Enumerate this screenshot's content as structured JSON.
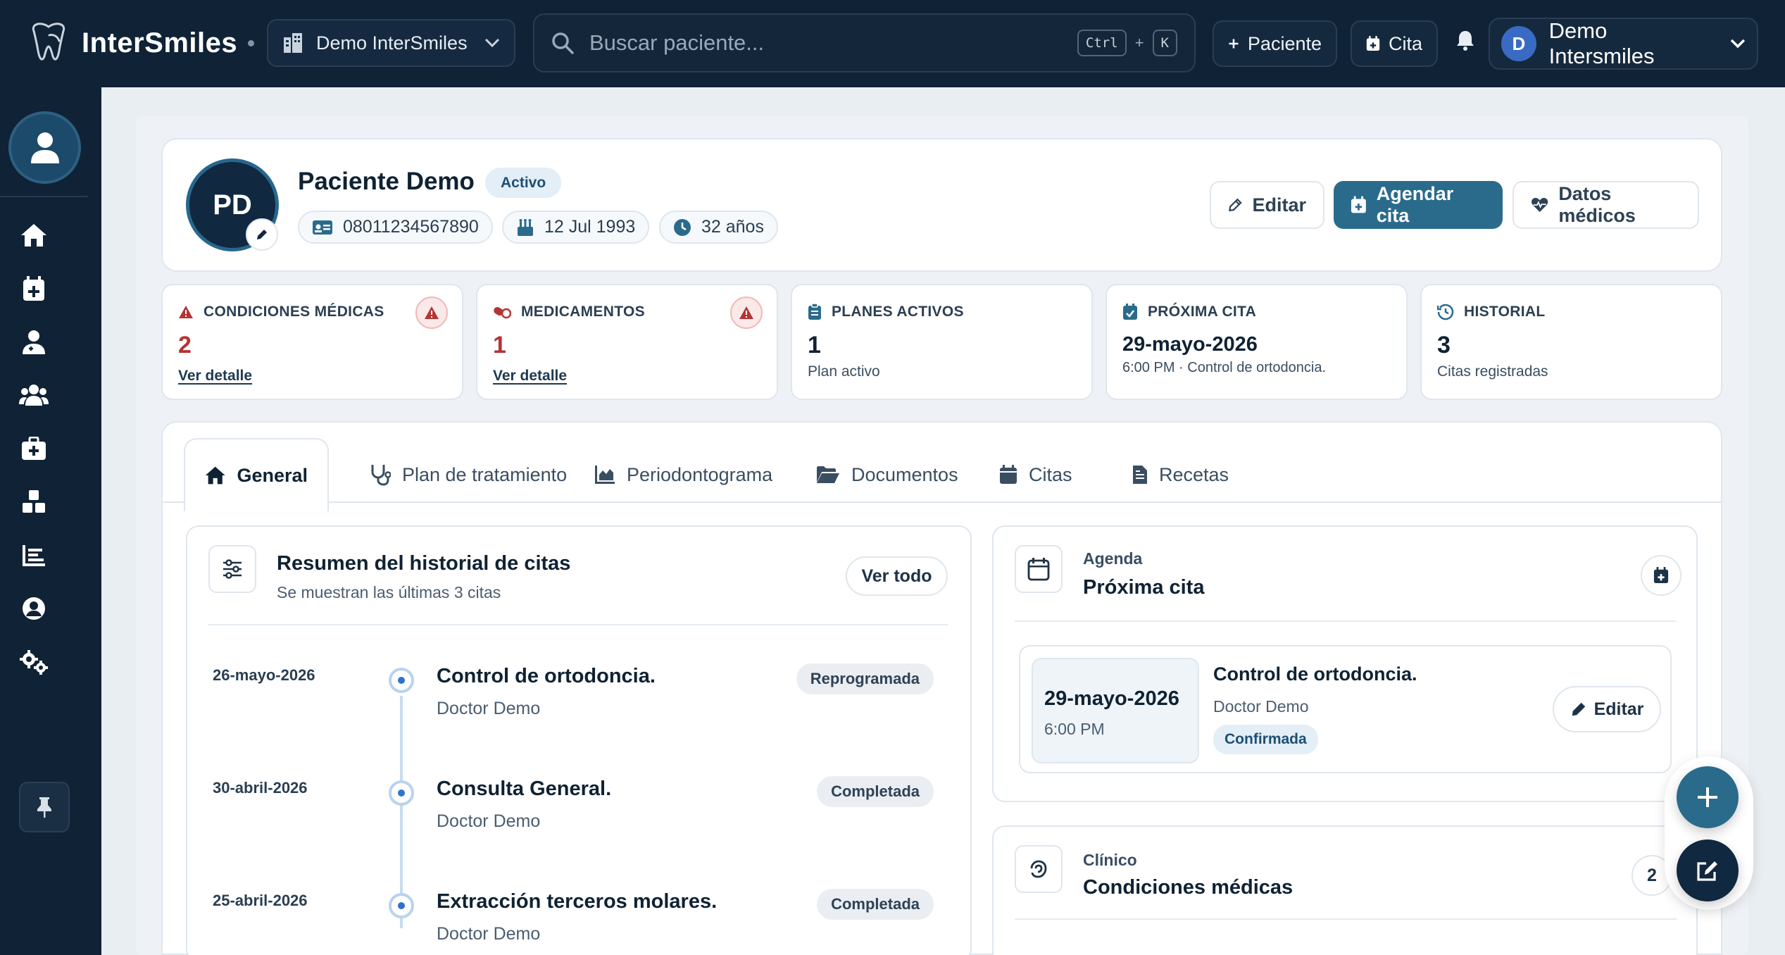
{
  "app": {
    "name": "InterSmiles"
  },
  "topbar": {
    "clinic": "Demo InterSmiles",
    "search_placeholder": "Buscar paciente...",
    "kbd_ctrl": "Ctrl",
    "kbd_plus": "+",
    "kbd_k": "K",
    "btn_paciente": "Paciente",
    "btn_cita": "Cita",
    "user_initial": "D",
    "user_name": "Demo Intersmiles"
  },
  "patient": {
    "initials": "PD",
    "name": "Paciente Demo",
    "status": "Activo",
    "id_number": "08011234567890",
    "birthdate": "12 Jul 1993",
    "age": "32 años"
  },
  "header_actions": {
    "edit": "Editar",
    "schedule": "Agendar cita",
    "medical": "Datos médicos"
  },
  "stats": [
    {
      "title": "CONDICIONES MÉDICAS",
      "value": "2",
      "link": "Ver detalle"
    },
    {
      "title": "MEDICAMENTOS",
      "value": "1",
      "link": "Ver detalle"
    },
    {
      "title": "PLANES ACTIVOS",
      "value": "1",
      "sub": "Plan activo"
    },
    {
      "title": "PRÓXIMA CITA",
      "value": "29-mayo-2026",
      "sub": "6:00 PM · Control de ortodoncia."
    },
    {
      "title": "HISTORIAL",
      "value": "3",
      "sub": "Citas registradas"
    }
  ],
  "tabs": [
    "General",
    "Plan de tratamiento",
    "Periodontograma",
    "Documentos",
    "Citas",
    "Recetas"
  ],
  "history": {
    "title": "Resumen del historial de citas",
    "subtitle": "Se muestran las últimas 3 citas",
    "view_all": "Ver todo",
    "items": [
      {
        "date": "26-mayo-2026",
        "title": "Control de ortodoncia.",
        "doctor": "Doctor Demo",
        "status": "Reprogramada"
      },
      {
        "date": "30-abril-2026",
        "title": "Consulta General.",
        "doctor": "Doctor Demo",
        "status": "Completada"
      },
      {
        "date": "25-abril-2026",
        "title": "Extracción terceros molares.",
        "doctor": "Doctor Demo",
        "status": "Completada"
      }
    ]
  },
  "agenda": {
    "eyebrow": "Agenda",
    "title": "Próxima cita",
    "date": "29-mayo-2026",
    "time": "6:00 PM",
    "appt_title": "Control de ortodoncia.",
    "doctor": "Doctor Demo",
    "status": "Confirmada",
    "edit": "Editar"
  },
  "clinical": {
    "eyebrow": "Clínico",
    "title": "Condiciones médicas",
    "count": "2"
  },
  "colors": {
    "navy": "#0f2236",
    "primary": "#2a6b8c",
    "danger": "#b43434"
  }
}
